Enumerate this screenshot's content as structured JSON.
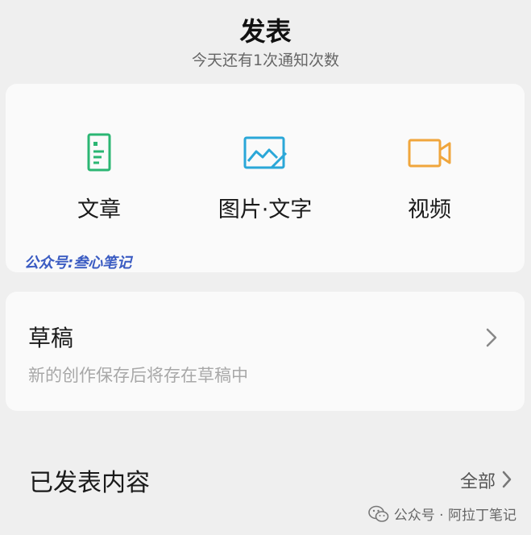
{
  "header": {
    "title": "发表",
    "subtitle": "今天还有1次通知次数"
  },
  "publish": {
    "items": [
      {
        "label": "文章",
        "icon": "article-icon",
        "color": "#2bb673"
      },
      {
        "label": "图片·文字",
        "icon": "image-text-icon",
        "color": "#2aa7d8"
      },
      {
        "label": "视频",
        "icon": "video-icon",
        "color": "#f0a63c"
      }
    ],
    "watermark": "公众号:叁心笔记"
  },
  "drafts": {
    "title": "草稿",
    "description": "新的创作保存后将存在草稿中"
  },
  "published": {
    "title": "已发表内容",
    "all_label": "全部"
  },
  "footer_watermark": "公众号 · 阿拉丁笔记",
  "colors": {
    "background": "#efefef",
    "card": "#fafafa",
    "watermark_blue": "#3a5bc2"
  }
}
